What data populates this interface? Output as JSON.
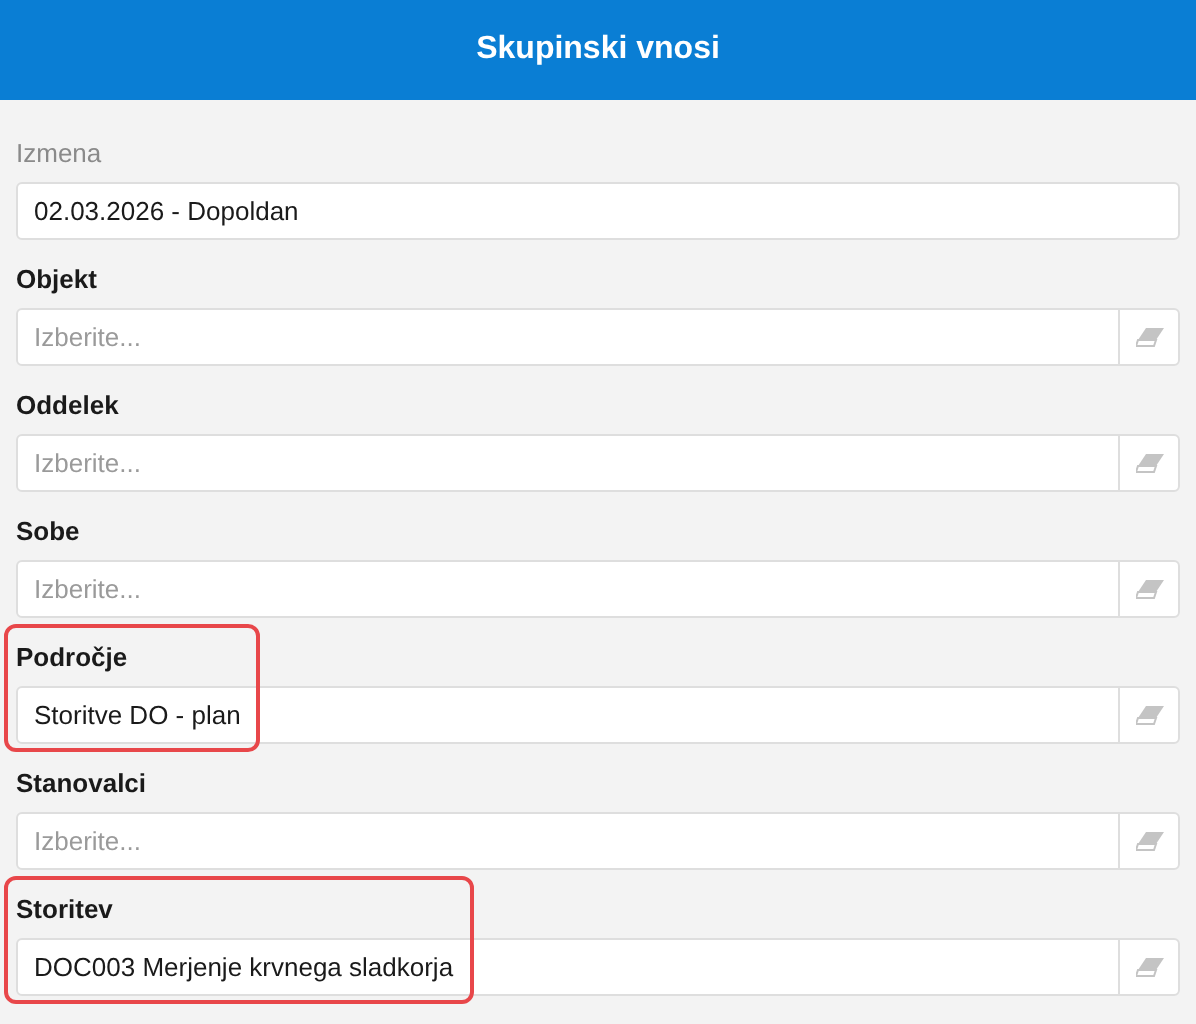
{
  "header": {
    "title": "Skupinski vnosi"
  },
  "fields": [
    {
      "kind": "readonly",
      "label": "Izmena",
      "value": "02.03.2026 - Dopoldan",
      "highlighted": false
    },
    {
      "kind": "select",
      "label": "Objekt",
      "placeholder": "Izberite...",
      "highlighted": false
    },
    {
      "kind": "select",
      "label": "Oddelek",
      "placeholder": "Izberite...",
      "highlighted": false
    },
    {
      "kind": "select",
      "label": "Sobe",
      "placeholder": "Izberite...",
      "highlighted": false
    },
    {
      "kind": "select",
      "label": "Področje",
      "value": "Storitve DO - plan",
      "highlighted": true
    },
    {
      "kind": "select",
      "label": "Stanovalci",
      "placeholder": "Izberite...",
      "highlighted": false
    },
    {
      "kind": "select",
      "label": "Storitev",
      "value": "DOC003 Merjenje krvnega sladkorja",
      "highlighted": true
    }
  ]
}
